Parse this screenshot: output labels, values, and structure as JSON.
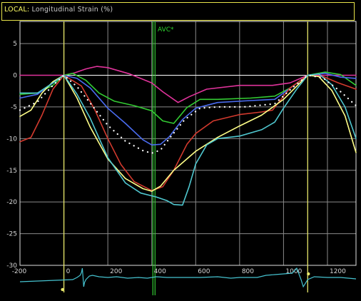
{
  "header": {
    "label": "LOCAL:",
    "title": "Longitudinal Strain (%)"
  },
  "marker": {
    "label": "AVC*",
    "x": 410
  },
  "colors": {
    "background": "#000000",
    "grid": "#8a8a8a",
    "frame": "#e0e0e0",
    "timing_line": "#e8e86a",
    "avc_line": "#33cc33",
    "ecg": "#45c2cf"
  },
  "chart_data": {
    "type": "line",
    "title": "Longitudinal Strain (%)",
    "xlim": [
      -200,
      1330
    ],
    "ylim": [
      -30,
      8.5
    ],
    "x_ticks": [
      -200,
      0,
      200,
      400,
      600,
      800,
      1000,
      1200
    ],
    "y_ticks": [
      5,
      0,
      -5,
      -10,
      -15,
      -20,
      -25,
      -30
    ],
    "grid": true,
    "vertical_markers": [
      0,
      1110
    ],
    "series": [
      {
        "color": "#e0339b",
        "style": "solid",
        "points": [
          [
            -200,
            0
          ],
          [
            0,
            0
          ],
          [
            50,
            0.4
          ],
          [
            100,
            1.0
          ],
          [
            150,
            1.4
          ],
          [
            200,
            1.2
          ],
          [
            300,
            0.2
          ],
          [
            400,
            -1.2
          ],
          [
            450,
            -2.6
          ],
          [
            520,
            -4.3
          ],
          [
            570,
            -3.4
          ],
          [
            650,
            -2.2
          ],
          [
            800,
            -1.6
          ],
          [
            950,
            -1.6
          ],
          [
            1030,
            -1.2
          ],
          [
            1110,
            0
          ],
          [
            1200,
            0
          ],
          [
            1330,
            0
          ]
        ]
      },
      {
        "color": "#33cc33",
        "style": "solid",
        "points": [
          [
            -200,
            -3.0
          ],
          [
            -120,
            -2.8
          ],
          [
            -50,
            -1.6
          ],
          [
            0,
            0
          ],
          [
            40,
            0.3
          ],
          [
            100,
            -0.8
          ],
          [
            160,
            -2.8
          ],
          [
            230,
            -4.1
          ],
          [
            320,
            -4.8
          ],
          [
            400,
            -5.6
          ],
          [
            450,
            -7.2
          ],
          [
            500,
            -7.6
          ],
          [
            560,
            -5.1
          ],
          [
            620,
            -3.8
          ],
          [
            700,
            -3.8
          ],
          [
            850,
            -3.6
          ],
          [
            960,
            -3.3
          ],
          [
            1030,
            -2.0
          ],
          [
            1110,
            0
          ],
          [
            1190,
            0.5
          ],
          [
            1260,
            0.1
          ],
          [
            1330,
            -1.6
          ]
        ]
      },
      {
        "color": "#4a6cf0",
        "style": "solid",
        "points": [
          [
            -200,
            -3.6
          ],
          [
            -120,
            -3.0
          ],
          [
            -50,
            -1.2
          ],
          [
            0,
            0
          ],
          [
            60,
            -0.5
          ],
          [
            120,
            -2.0
          ],
          [
            200,
            -5.2
          ],
          [
            280,
            -7.6
          ],
          [
            360,
            -10.2
          ],
          [
            400,
            -11.0
          ],
          [
            440,
            -10.9
          ],
          [
            480,
            -9.7
          ],
          [
            540,
            -7.0
          ],
          [
            600,
            -5.2
          ],
          [
            700,
            -4.3
          ],
          [
            850,
            -4.0
          ],
          [
            960,
            -3.8
          ],
          [
            1040,
            -1.8
          ],
          [
            1110,
            0
          ],
          [
            1190,
            0.3
          ],
          [
            1260,
            -0.3
          ],
          [
            1330,
            -0.5
          ]
        ]
      },
      {
        "color": "#d33a2e",
        "style": "solid",
        "points": [
          [
            -200,
            -10.5
          ],
          [
            -150,
            -9.8
          ],
          [
            -100,
            -6.3
          ],
          [
            -50,
            -2.2
          ],
          [
            0,
            0
          ],
          [
            80,
            -1.7
          ],
          [
            140,
            -5.4
          ],
          [
            200,
            -10.0
          ],
          [
            260,
            -14.1
          ],
          [
            320,
            -16.8
          ],
          [
            400,
            -18.2
          ],
          [
            450,
            -17.6
          ],
          [
            500,
            -15.0
          ],
          [
            560,
            -10.9
          ],
          [
            600,
            -9.2
          ],
          [
            680,
            -7.2
          ],
          [
            800,
            -6.2
          ],
          [
            900,
            -5.8
          ],
          [
            950,
            -5.5
          ],
          [
            1030,
            -2.0
          ],
          [
            1110,
            0
          ],
          [
            1180,
            -0.2
          ],
          [
            1250,
            -1.2
          ],
          [
            1330,
            -2.2
          ]
        ]
      },
      {
        "color": "#ffff88",
        "style": "solid",
        "points": [
          [
            -200,
            -6.5
          ],
          [
            -150,
            -5.5
          ],
          [
            -100,
            -2.8
          ],
          [
            -50,
            -1.0
          ],
          [
            0,
            0
          ],
          [
            60,
            -3.6
          ],
          [
            120,
            -8.2
          ],
          [
            200,
            -13.2
          ],
          [
            280,
            -16.3
          ],
          [
            360,
            -17.9
          ],
          [
            400,
            -18.3
          ],
          [
            440,
            -17.5
          ],
          [
            500,
            -15.0
          ],
          [
            600,
            -12.0
          ],
          [
            700,
            -9.8
          ],
          [
            800,
            -8.0
          ],
          [
            900,
            -6.3
          ],
          [
            1000,
            -3.8
          ],
          [
            1110,
            0
          ],
          [
            1160,
            -0.2
          ],
          [
            1220,
            -2.4
          ],
          [
            1280,
            -6.4
          ],
          [
            1330,
            -12.2
          ]
        ]
      },
      {
        "color": "#4fc7cf",
        "style": "solid",
        "points": [
          [
            -200,
            -2.8
          ],
          [
            -120,
            -2.8
          ],
          [
            -50,
            -1.2
          ],
          [
            0,
            0
          ],
          [
            60,
            -3.0
          ],
          [
            120,
            -6.8
          ],
          [
            200,
            -13.0
          ],
          [
            280,
            -17.0
          ],
          [
            350,
            -18.6
          ],
          [
            420,
            -19.2
          ],
          [
            470,
            -19.8
          ],
          [
            500,
            -20.4
          ],
          [
            540,
            -20.5
          ],
          [
            570,
            -17.6
          ],
          [
            600,
            -14.0
          ],
          [
            650,
            -11.0
          ],
          [
            700,
            -10.0
          ],
          [
            800,
            -9.6
          ],
          [
            900,
            -8.6
          ],
          [
            960,
            -7.4
          ],
          [
            1000,
            -5.2
          ],
          [
            1060,
            -2.2
          ],
          [
            1110,
            0
          ],
          [
            1160,
            0.2
          ],
          [
            1220,
            -1.5
          ],
          [
            1280,
            -5.0
          ],
          [
            1330,
            -10.0
          ]
        ]
      },
      {
        "color": "#ffffff",
        "style": "dotted",
        "points": [
          [
            -200,
            -5.5
          ],
          [
            -120,
            -4.2
          ],
          [
            -50,
            -1.6
          ],
          [
            0,
            0
          ],
          [
            60,
            -1.8
          ],
          [
            120,
            -4.4
          ],
          [
            200,
            -7.9
          ],
          [
            280,
            -10.4
          ],
          [
            360,
            -11.9
          ],
          [
            400,
            -12.3
          ],
          [
            440,
            -11.8
          ],
          [
            480,
            -10.0
          ],
          [
            550,
            -7.0
          ],
          [
            620,
            -5.2
          ],
          [
            700,
            -5.0
          ],
          [
            820,
            -5.0
          ],
          [
            960,
            -4.5
          ],
          [
            1040,
            -2.0
          ],
          [
            1110,
            0
          ],
          [
            1180,
            -0.4
          ],
          [
            1260,
            -2.6
          ],
          [
            1330,
            -4.8
          ]
        ]
      }
    ]
  }
}
